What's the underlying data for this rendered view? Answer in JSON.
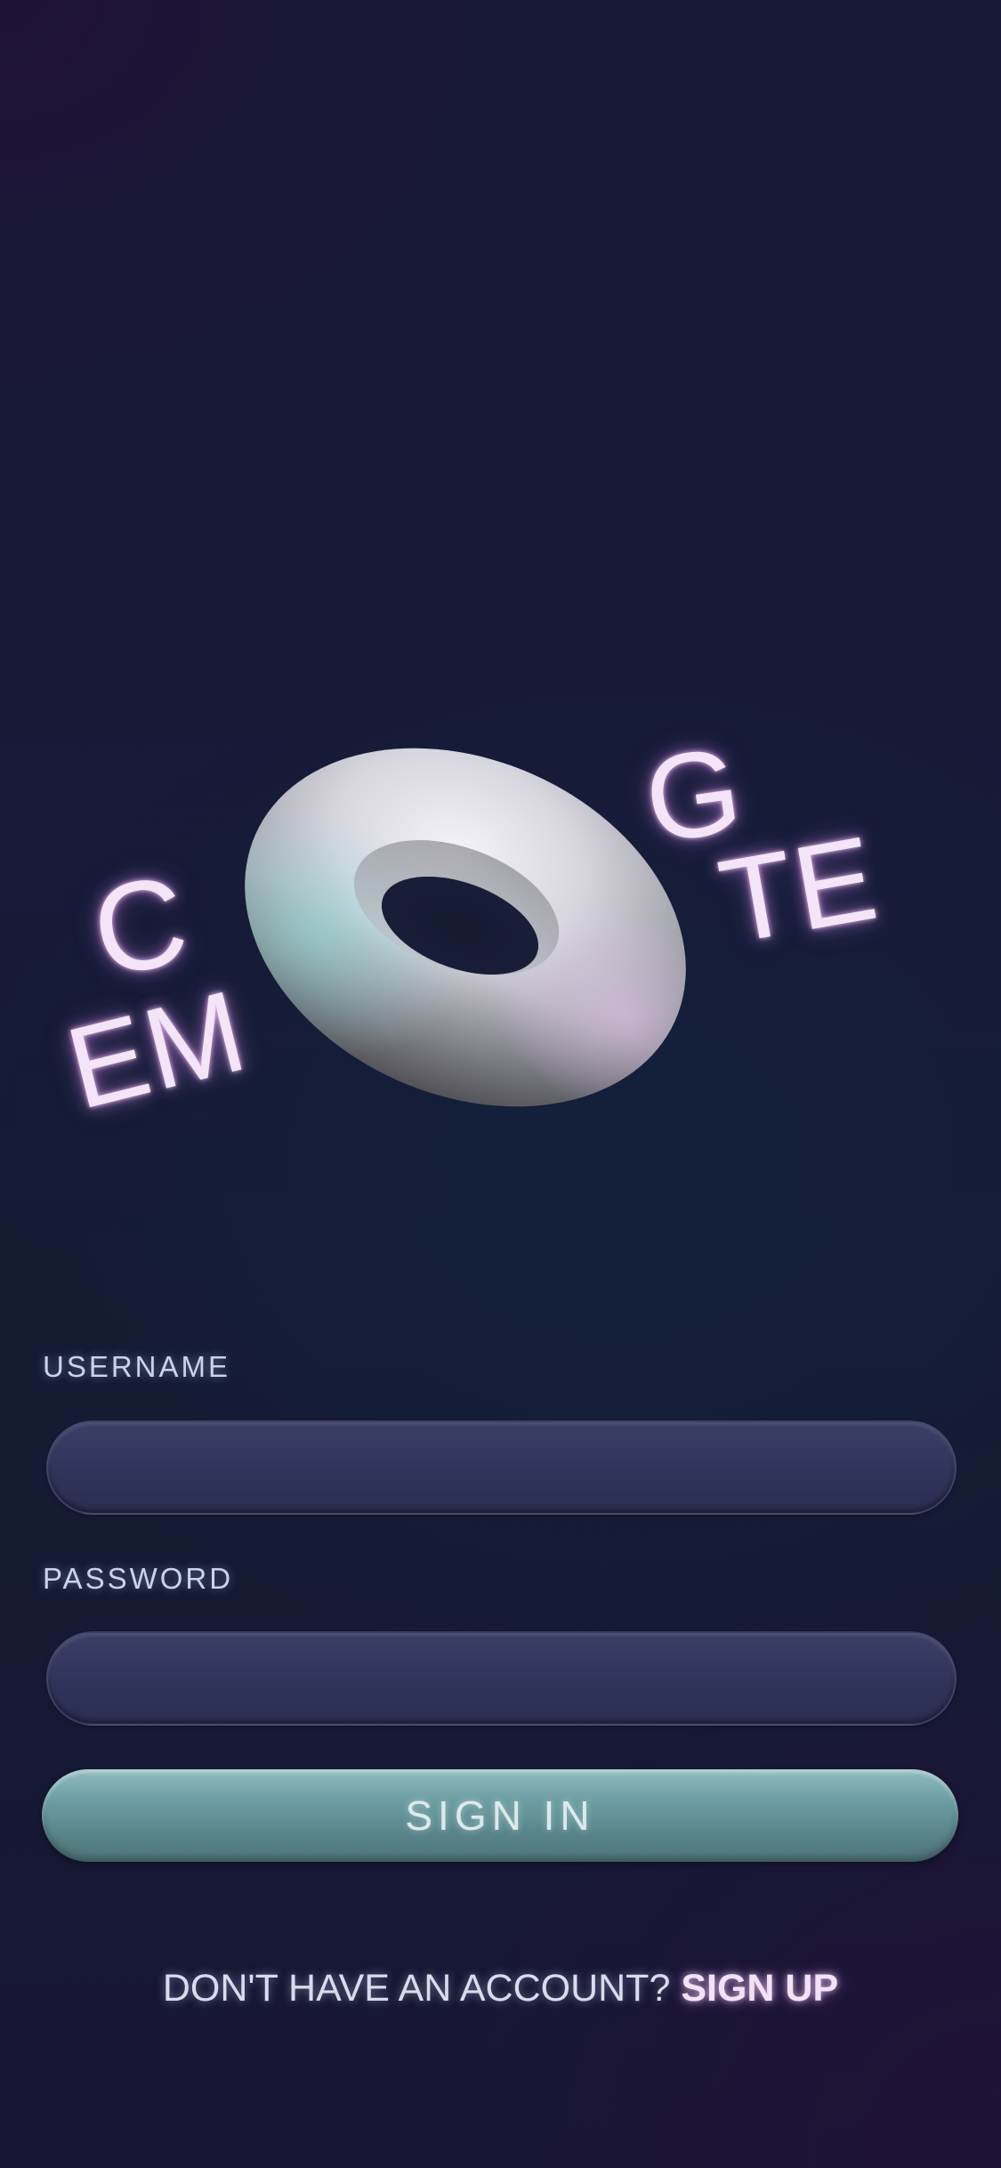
{
  "logo": {
    "letters_c": "C",
    "letters_em": "EM",
    "letters_g": "G",
    "letters_te": "TE"
  },
  "form": {
    "username_label": "USERNAME",
    "username_value": "",
    "password_label": "PASSWORD",
    "password_value": "",
    "sign_in_label": "SIGN IN"
  },
  "footer": {
    "prompt_text": "DON'T HAVE AN ACCOUNT?",
    "sign_up_label": "SIGN UP"
  },
  "colors": {
    "background": "#171a38",
    "glow_text": "#f3e4f7",
    "input_fill": "#30345a",
    "button_fill": "#6b9da2"
  }
}
